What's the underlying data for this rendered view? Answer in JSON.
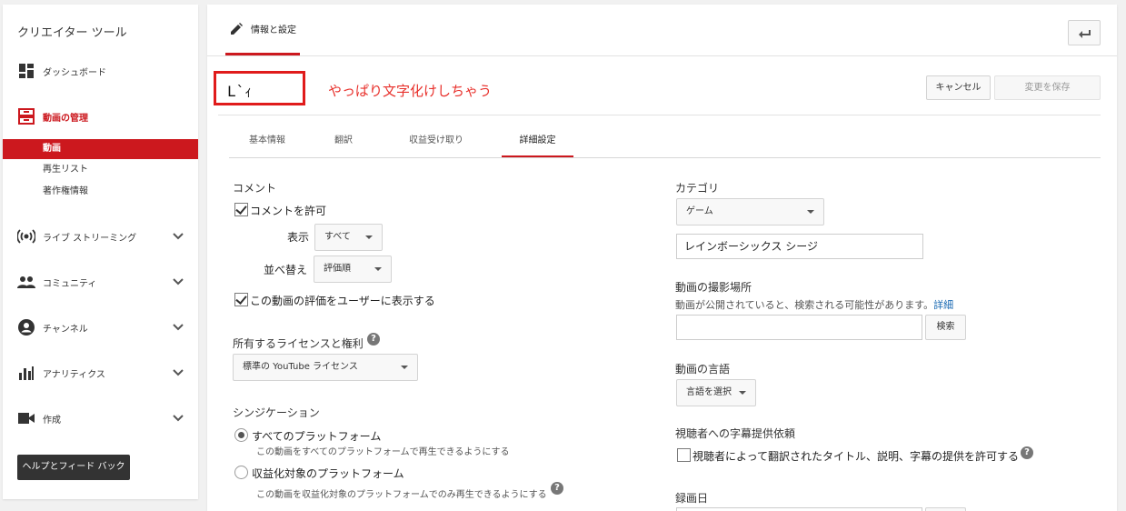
{
  "sidebar": {
    "title": "クリエイター ツール",
    "items": [
      {
        "label": "ダッシュボード"
      },
      {
        "label": "動画の管理"
      },
      {
        "label": "ライブ ストリーミング"
      },
      {
        "label": "コミュニティ"
      },
      {
        "label": "チャンネル"
      },
      {
        "label": "アナリティクス"
      },
      {
        "label": "作成"
      }
    ],
    "subitems": [
      {
        "label": "動画"
      },
      {
        "label": "再生リスト"
      },
      {
        "label": "著作権情報"
      }
    ],
    "help_label": "ヘルプとフィード バック"
  },
  "header": {
    "tab_label": "情報と設定",
    "video_title": "L`ｨ",
    "annotation": "やっぱり文字化けしちゃう",
    "cancel_label": "キャンセル",
    "save_label": "変更を保存"
  },
  "subtabs": [
    {
      "label": "基本情報"
    },
    {
      "label": "翻訳"
    },
    {
      "label": "収益受け取り"
    },
    {
      "label": "詳細設定"
    }
  ],
  "left": {
    "comments_label": "コメント",
    "allow_comments": "コメントを許可",
    "display_label": "表示",
    "display_value": "すべて",
    "sort_label": "並べ替え",
    "sort_value": "評価順",
    "show_ratings": "この動画の評価をユーザーに表示する",
    "license_label": "所有するライセンスと権利",
    "license_value": "標準の YouTube ライセンス",
    "syndication_label": "シンジケーション",
    "platform_all": "すべてのプラットフォーム",
    "platform_all_hint": "この動画をすべてのプラットフォームで再生できるようにする",
    "platform_monetized": "収益化対象のプラットフォーム",
    "platform_monetized_hint": "この動画を収益化対象のプラットフォームでのみ再生できるようにする"
  },
  "right": {
    "category_label": "カテゴリ",
    "category_value": "ゲーム",
    "game_title_value": "レインボーシックス シージ",
    "location_label": "動画の撮影場所",
    "location_hint": "動画が公開されていると、検索される可能性があります。",
    "location_link": "詳細",
    "location_placeholder": "",
    "search_label": "検索",
    "language_label": "動画の言語",
    "language_value": "言語を選択",
    "caption_label": "視聴者への字幕提供依頼",
    "caption_text": "視聴者によって翻訳されたタイトル、説明、字幕の提供を許可する",
    "record_date_label": "録画日"
  },
  "colors": {
    "accent": "#cc181e",
    "annotation": "#e8302b"
  }
}
